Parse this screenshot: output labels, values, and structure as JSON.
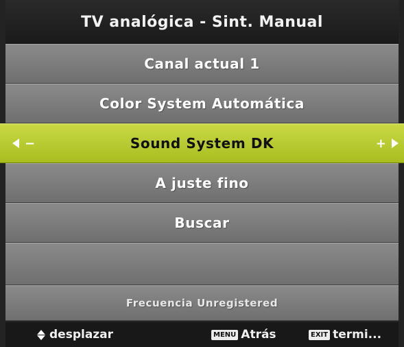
{
  "title": "TV analógica - Sint. Manual",
  "menu": {
    "current_channel": "Canal actual 1",
    "color_system": "Color System Automática",
    "sound_system": "Sound System DK",
    "sound_minus": "−",
    "sound_plus": "+",
    "fine_tune": "A juste fino",
    "search": "Buscar",
    "frequency": "Frecuencia Unregistered"
  },
  "footer": {
    "scroll_label": "desplazar",
    "menu_key": "MENU",
    "back_label": "Atrás",
    "exit_key": "EXIT",
    "exit_label": "termi..."
  },
  "colors": {
    "selected_row": "#bccd30",
    "row": "#7d7d7d",
    "background": "#232323"
  },
  "icons": {
    "left_arrow": "left-arrow-icon",
    "right_arrow": "right-arrow-icon",
    "updown": "up-down-arrows-icon"
  }
}
